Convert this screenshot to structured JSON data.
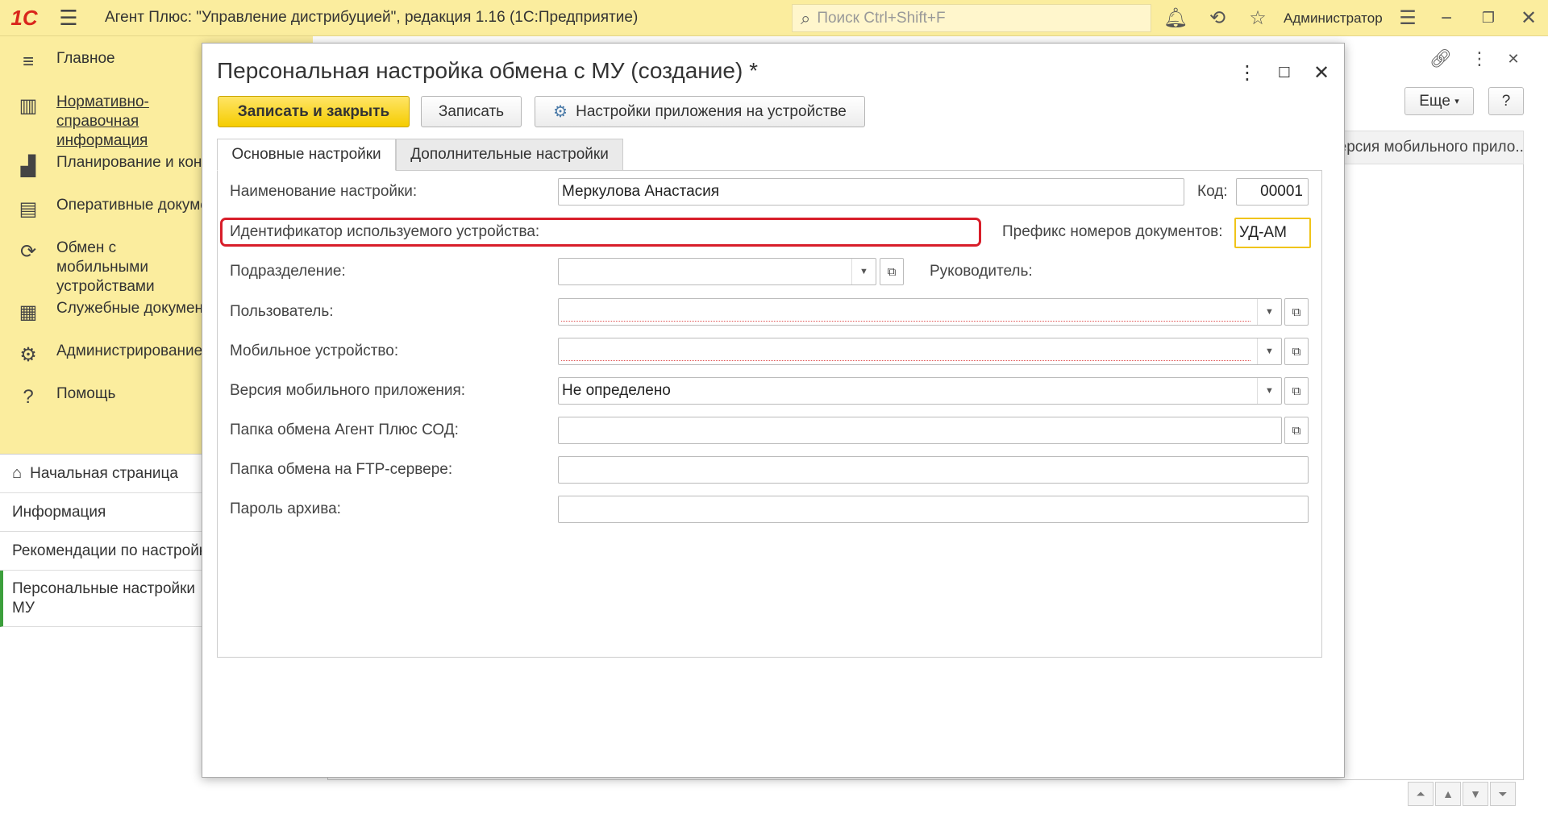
{
  "topbar": {
    "logo": "1С",
    "app_title": "Агент Плюс: \"Управление дистрибуцией\", редакция 1.16  (1С:Предприятие)",
    "search_placeholder": "Поиск Ctrl+Shift+F",
    "user": "Администратор"
  },
  "sidebar": {
    "sections": [
      {
        "icon": "hamburger-icon",
        "label": "Главное"
      },
      {
        "icon": "book-icon",
        "label": "Нормативно-справочная информация"
      },
      {
        "icon": "chart-icon",
        "label": "Планирование и контроль"
      },
      {
        "icon": "documents-icon",
        "label": "Оперативные документы"
      },
      {
        "icon": "sync-icon",
        "label": "Обмен с мобильными устройствами"
      },
      {
        "icon": "service-docs-icon",
        "label": "Служебные документы"
      },
      {
        "icon": "gear-icon",
        "label": "Администрирование"
      },
      {
        "icon": "help-icon",
        "label": "Помощь"
      }
    ],
    "open_items": [
      {
        "label": "Начальная страница"
      },
      {
        "label": "Информация"
      },
      {
        "label": "Рекомендации по настройке"
      },
      {
        "label": "Персональные настройки МУ"
      }
    ]
  },
  "background": {
    "more_label": "Еще",
    "help_label": "?",
    "column_header": "Версия мобильного прило..."
  },
  "modal": {
    "title": "Персональная настройка обмена с МУ (создание) *",
    "buttons": {
      "save_close": "Записать и закрыть",
      "save": "Записать",
      "device_settings": "Настройки приложения на устройстве"
    },
    "tabs": [
      "Основные настройки",
      "Дополнительные настройки"
    ],
    "fields": {
      "name_label": "Наименование настройки:",
      "name_value": "Меркулова Анастасия",
      "code_label": "Код:",
      "code_value": "00001",
      "device_id_label": "Идентификатор используемого устройства:",
      "prefix_label": "Префикс номеров документов:",
      "prefix_value": "УД-АМ",
      "division_label": "Подразделение:",
      "division_value": "",
      "manager_label": "Руководитель:",
      "user_label": "Пользователь:",
      "user_value": "",
      "device_label": "Мобильное устройство:",
      "device_value": "",
      "app_version_label": "Версия мобильного приложения:",
      "app_version_value": "Не определено",
      "exchange_folder_label": "Папка обмена Агент Плюс СОД:",
      "exchange_folder_value": "",
      "ftp_folder_label": "Папка обмена на FTP-сервере:",
      "ftp_folder_value": "",
      "archive_password_label": "Пароль архива:",
      "archive_password_value": ""
    }
  },
  "colors": {
    "accent_yellow": "#fbed9e",
    "primary_button": "#f5cc00",
    "highlight_red": "#d81e2a",
    "active_green": "#3c9f3c"
  }
}
